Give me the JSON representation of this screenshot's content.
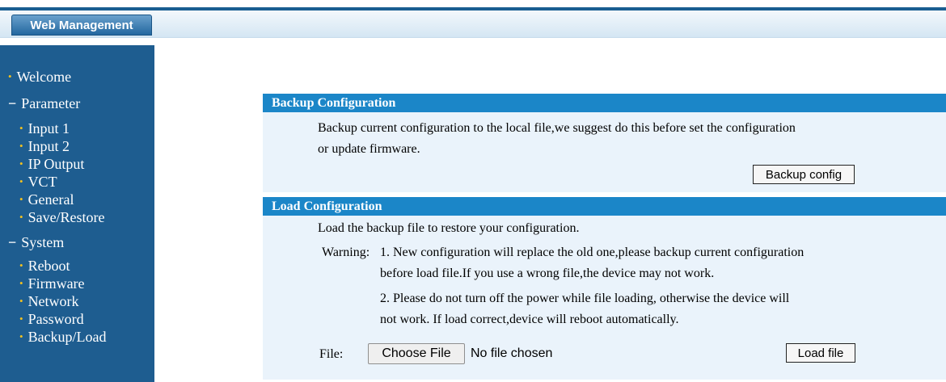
{
  "header": {
    "brand": "Web Management"
  },
  "sidebar": {
    "items": [
      {
        "label": "Welcome",
        "type": "bullet",
        "level": 0
      },
      {
        "label": "Parameter",
        "type": "section",
        "level": 0
      },
      {
        "label": "Input 1",
        "type": "bullet",
        "level": 1
      },
      {
        "label": "Input 2",
        "type": "bullet",
        "level": 1
      },
      {
        "label": "IP Output",
        "type": "bullet",
        "level": 1
      },
      {
        "label": "VCT",
        "type": "bullet",
        "level": 1
      },
      {
        "label": "General",
        "type": "bullet",
        "level": 1
      },
      {
        "label": "Save/Restore",
        "type": "bullet",
        "level": 1
      },
      {
        "label": "System",
        "type": "section",
        "level": 0
      },
      {
        "label": "Reboot",
        "type": "bullet",
        "level": 1
      },
      {
        "label": "Firmware",
        "type": "bullet",
        "level": 1
      },
      {
        "label": "Network",
        "type": "bullet",
        "level": 1
      },
      {
        "label": "Password",
        "type": "bullet",
        "level": 1
      },
      {
        "label": "Backup/Load",
        "type": "bullet",
        "level": 1
      }
    ]
  },
  "backup": {
    "title": "Backup Configuration",
    "desc_line1": "Backup current configuration to the local file,we suggest do this before set the configuration",
    "desc_line2": "or update firmware.",
    "button": "Backup config"
  },
  "load": {
    "title": "Load Configuration",
    "desc": "Load the backup file to restore your configuration.",
    "warning_label": "Warning:",
    "warn1_line1": "1. New configuration will replace the old one,please backup current configuration",
    "warn1_line2": "before load file.If you use a wrong file,the device may not work.",
    "warn2_line1": "2. Please do not turn off the power while file loading, otherwise the device will",
    "warn2_line2": "not work. If load correct,device will reboot automatically.",
    "file_label": "File:",
    "choose_button": "Choose File",
    "file_status": "No file chosen",
    "load_button": "Load file"
  },
  "icons": {
    "bullet": "bullet-icon",
    "section": "minus-icon"
  },
  "colors": {
    "sidebar": "#1e5d90",
    "panel_header": "#1b86c8",
    "panel_body": "#eaf3fb",
    "bullet": "#f0c020"
  }
}
